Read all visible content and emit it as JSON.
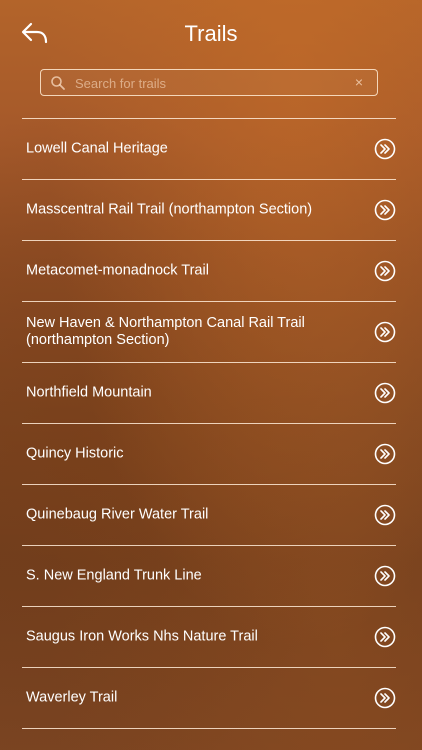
{
  "header": {
    "title": "Trails",
    "back_icon": "back-arrow-icon"
  },
  "search": {
    "placeholder": "Search for trails",
    "value": "",
    "icon": "search-icon",
    "clear_icon": "close-icon",
    "clear_symbol": "×"
  },
  "trails": [
    {
      "label": "Lowell Canal Heritage"
    },
    {
      "label": "Masscentral Rail Trail (northampton Section)"
    },
    {
      "label": "Metacomet-monadnock Trail"
    },
    {
      "label": "New Haven & Northampton Canal Rail Trail (northampton Section)"
    },
    {
      "label": "Northfield Mountain"
    },
    {
      "label": "Quincy Historic"
    },
    {
      "label": "Quinebaug River Water Trail"
    },
    {
      "label": "S. New England Trunk Line"
    },
    {
      "label": "Saugus Iron Works Nhs Nature Trail"
    },
    {
      "label": "Waverley Trail"
    }
  ],
  "colors": {
    "background": "#8f4d25",
    "text": "#ffffff",
    "divider": "#ffebd7"
  }
}
